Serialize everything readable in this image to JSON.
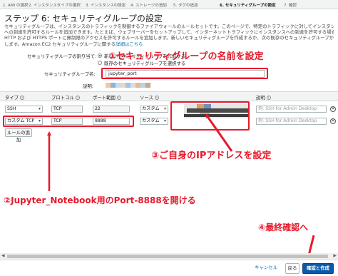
{
  "wizard": {
    "tabs": [
      "1. AMI の選択",
      "2. インスタンスタイプの選択",
      "3. インスタンスの設定",
      "4. ストレージの追加",
      "5. タグの追加",
      "6. セキュリティグループの設定",
      "7. 確認"
    ],
    "active_tab_index": 5
  },
  "page": {
    "title": "ステップ 6: セキュリティグループの設定",
    "description_lines": [
      "セキュリティグループは、インスタンスのトラフィックを制御するファイアウォールのルールセットです。このページで、特定のトラフィックに対してインスタンス",
      "への到達を許可するルールを追加できます。たとえば、ウェブサーバーをセットアップして、インターネットトラフィックにインスタンスへの到達を許可する場合、",
      "HTTP および HTTPS ポートに無制限のアクセスを許可するルールを追加します。新しいセキュリティグループを作成するか、次の既存のセキュリティグループから選択",
      "します。Amazon EC2 セキュリティグループに関する"
    ],
    "description_link": "詳細はこちら"
  },
  "security_group": {
    "assign_label": "セキュリティグループの割り当て:",
    "option_new": "新しいセキュリティグループを作成する",
    "option_existing": "既存のセキュリティグループを選択する",
    "name_label": "セキュリティグループ名:",
    "name_value": "jupyter_port",
    "description_label": "説明:",
    "description_colors": [
      "#f4c7a1",
      "#8fb3d9",
      "#c9dceb",
      "#f2d5b8",
      "#9ec5e8",
      "#dcdcdc",
      "#e7b98f",
      "#b9d3ea",
      "#c8a98a"
    ]
  },
  "rules_table": {
    "headers": {
      "type": "タイプ",
      "protocol": "プロトコル",
      "port_range": "ポート範囲",
      "source": "ソース",
      "description": "説明"
    },
    "rows": [
      {
        "type": "SSH",
        "protocol": "TCP",
        "port": "22",
        "source": "カスタム",
        "description_placeholder": "例: SSH for Admin Desktop"
      },
      {
        "type": "カスタム TCP",
        "protocol": "TCP",
        "port": "8888",
        "source": "カスタム",
        "description_placeholder": "例: SSH for Admin Desktop"
      }
    ],
    "add_rule_label": "ルールの追加"
  },
  "annotations": {
    "step1": "①セキュリティグループの名前を設定",
    "step2": "②Jupyter_Notebook用のPort-8888を開ける",
    "step3": "③ご自身のIPアドレスを設定",
    "step4": "④最終確認へ"
  },
  "footer": {
    "cancel": "キャンセル",
    "back": "戻る",
    "review_launch": "確認と作成"
  },
  "colors": {
    "annotation_red": "#e8192c",
    "primary_blue": "#0b58a8",
    "link_blue": "#0073bb",
    "ip_redaction": [
      "#d9a066",
      "#6d8fbf",
      "#4a4a4a",
      "#e0a96d",
      "#3c3c3c"
    ]
  },
  "icons": [
    "info-icon",
    "remove-icon",
    "scroll-left-icon",
    "scroll-right-icon",
    "arrow-icon"
  ]
}
